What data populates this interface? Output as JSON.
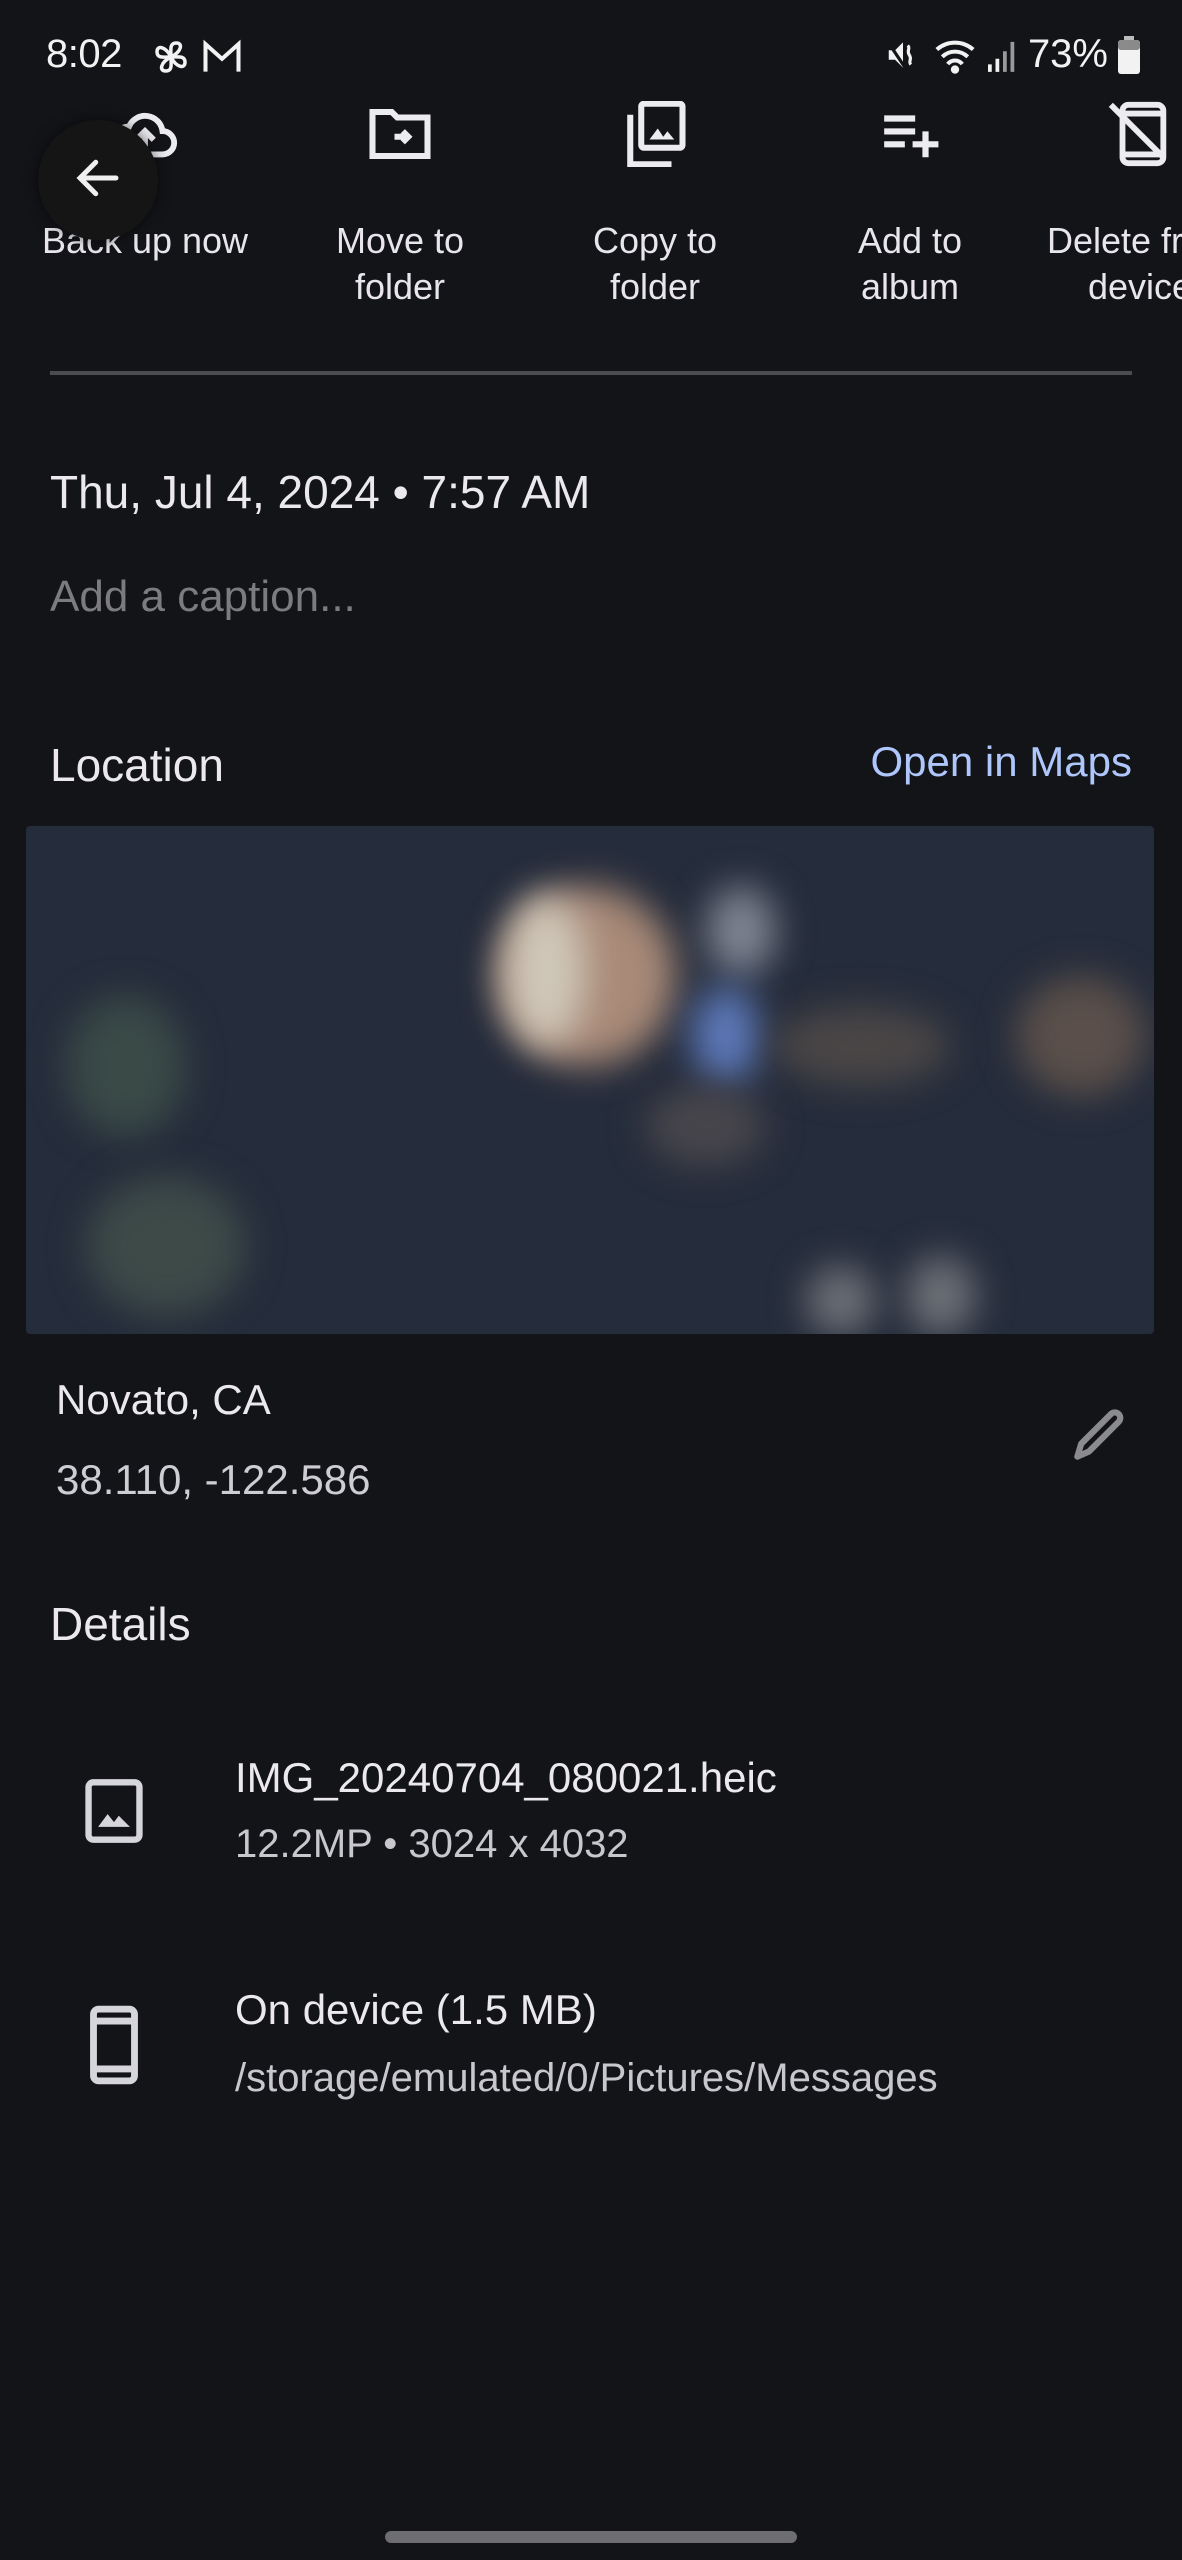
{
  "status_bar": {
    "time": "8:02",
    "left_icons": [
      "pinwheel-icon",
      "gmail-icon"
    ],
    "right_icons": [
      "mute-icon",
      "wifi-icon",
      "signal-icon"
    ],
    "battery": "73%"
  },
  "actions": [
    {
      "icon": "cloud-upload-icon",
      "label": "Back up now"
    },
    {
      "icon": "move-to-folder-icon",
      "label": "Move to\nfolder"
    },
    {
      "icon": "copy-to-folder-icon",
      "label": "Copy to\nfolder"
    },
    {
      "icon": "playlist-add-icon",
      "label": "Add to\nalbum"
    },
    {
      "icon": "delete-from-device-icon",
      "label": "Delete from\ndevice"
    }
  ],
  "back_button": {
    "icon": "arrow-back-icon"
  },
  "datetime": "Thu, Jul 4, 2024  •  7:57 AM",
  "caption_placeholder": "Add a caption...",
  "location": {
    "heading": "Location",
    "open_maps_label": "Open in Maps",
    "place": "Novato, CA",
    "coordinates": "38.110, -122.586",
    "edit_icon": "pencil-icon"
  },
  "details": {
    "heading": "Details",
    "file": {
      "icon": "image-icon",
      "name": "IMG_20240704_080021.heic",
      "info": "12.2MP  •  3024 x 4032"
    },
    "storage": {
      "icon": "phone-icon",
      "title": "On device (1.5 MB)",
      "path": "/storage/emulated/0/Pictures/Messages"
    }
  },
  "colors": {
    "background": "#131418",
    "accent_link": "#aec6fb",
    "text_primary": "#ebe9ee",
    "text_muted": "#7b7b80"
  }
}
